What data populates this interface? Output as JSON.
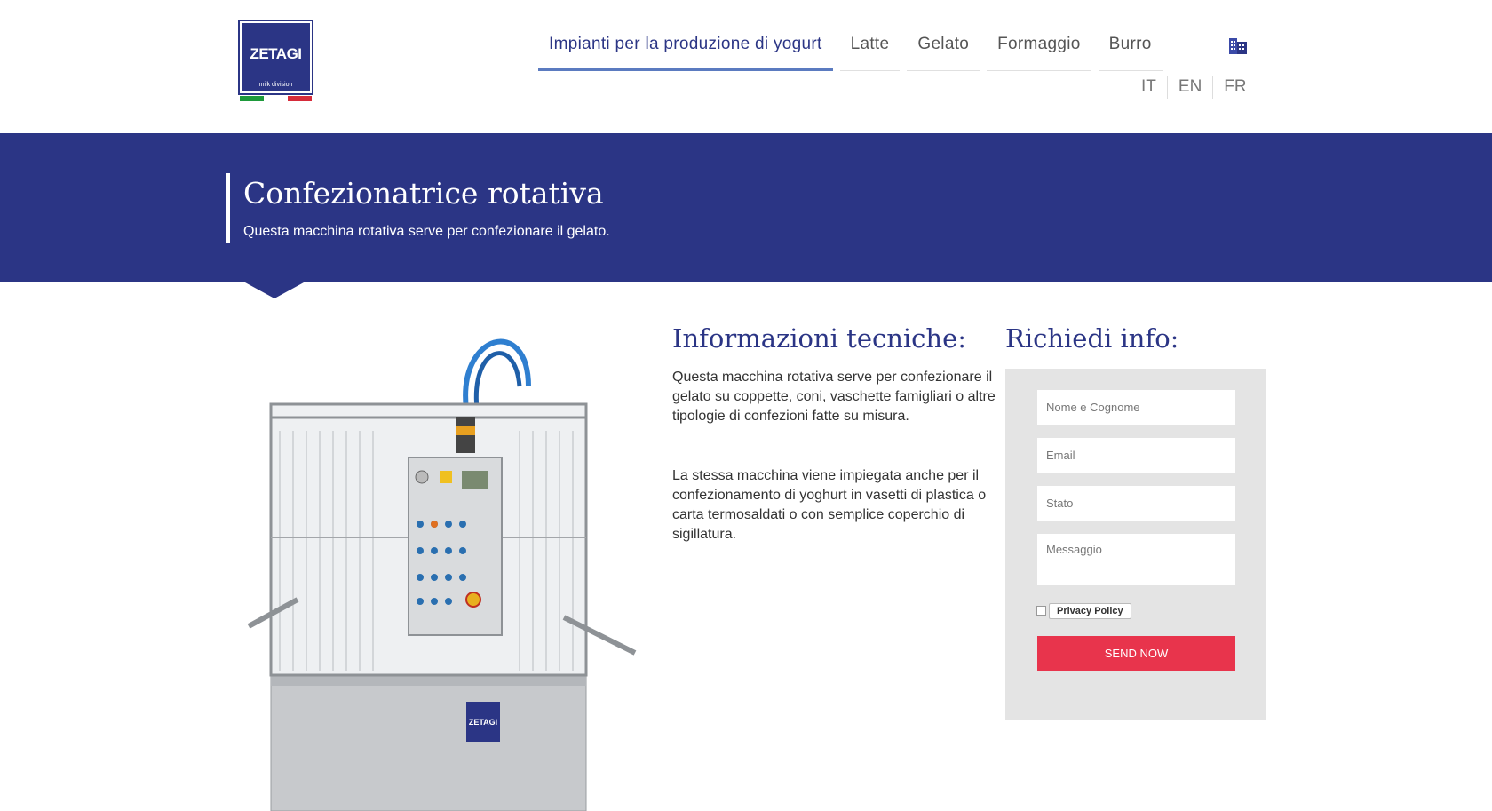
{
  "logo": {
    "name": "ZETAGI",
    "tagline": "milk division"
  },
  "nav": {
    "items": [
      {
        "label": "Impianti per la produzione di yogurt",
        "active": true
      },
      {
        "label": "Latte",
        "active": false
      },
      {
        "label": "Gelato",
        "active": false
      },
      {
        "label": "Formaggio",
        "active": false
      },
      {
        "label": "Burro",
        "active": false
      }
    ],
    "languages": [
      "IT",
      "EN",
      "FR"
    ]
  },
  "banner": {
    "title": "Confezionatrice rotativa",
    "subtitle": "Questa macchina rotativa serve per confezionare il gelato."
  },
  "machine_panel_logo": "ZETAGI",
  "info": {
    "title": "Informazioni tecniche:",
    "paragraphs": [
      "Questa macchina rotativa serve per confezionare il gelato su coppette, coni, vaschette famigliari o altre tipologie di confezioni fatte su misura.",
      "La stessa macchina viene impiegata anche per il confezionamento di yoghurt in vasetti di plastica o carta termosaldati o con semplice coperchio di sigillatura."
    ]
  },
  "form": {
    "title": "Richiedi info:",
    "name_placeholder": "Nome e Cognome",
    "email_placeholder": "Email",
    "state_placeholder": "Stato",
    "message_placeholder": "Messaggio",
    "privacy_label": "Privacy Policy",
    "send_label": "SEND NOW"
  },
  "colors": {
    "brand_blue": "#2b3585",
    "accent_red": "#e8344c",
    "nav_underline": "#5b7bc0",
    "form_bg": "#e4e4e4"
  },
  "icons": {
    "building": "building-icon"
  }
}
